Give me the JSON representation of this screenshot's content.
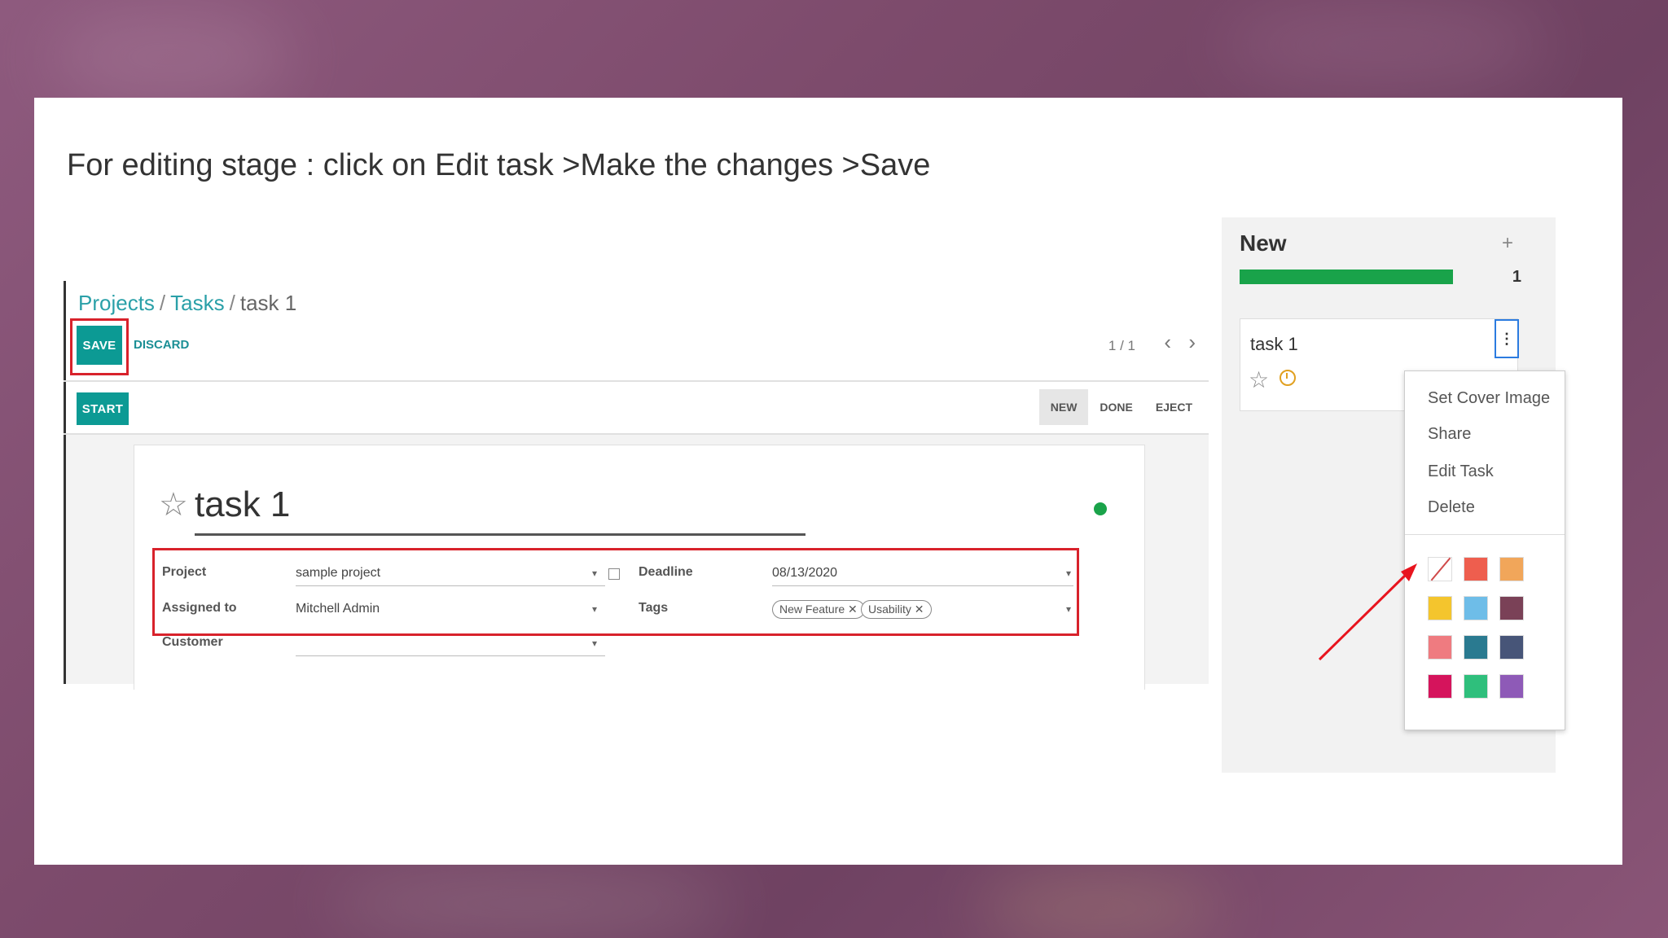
{
  "slide": {
    "caption": "For editing stage : click on Edit task >Make the changes >Save"
  },
  "form": {
    "breadcrumb": {
      "projects": "Projects",
      "tasks": "Tasks",
      "current": "task 1",
      "separator": "/"
    },
    "toolbar": {
      "save_label": "SAVE",
      "discard_label": "DISCARD",
      "pager": "1 / 1",
      "prev_icon": "chevron-left-icon",
      "next_icon": "chevron-right-icon"
    },
    "statusbar": {
      "start_label": "START",
      "stages": [
        "NEW",
        "DONE",
        "EJECT"
      ],
      "active_stage": "NEW"
    },
    "sheet": {
      "title": "task 1",
      "kanban_state_color": "#1aa34a",
      "fields": {
        "project_label": "Project",
        "project_value": "sample project",
        "assigned_label": "Assigned to",
        "assigned_value": "Mitchell Admin",
        "customer_label": "Customer",
        "customer_value": "",
        "deadline_label": "Deadline",
        "deadline_value": "08/13/2020",
        "tags_label": "Tags",
        "tags": [
          "New Feature",
          "Usability"
        ]
      }
    },
    "highlight_color": "#d8222b",
    "accent": "#0c9a94"
  },
  "kanban": {
    "column_title": "New",
    "column_count": "1",
    "progress_fraction": 1.0,
    "progress_color": "#19a34a",
    "card": {
      "title": "task 1",
      "menu_icon": "vertical-dots-icon"
    },
    "menu_items": [
      "Set Cover Image",
      "Share",
      "Edit Task",
      "Delete"
    ],
    "color_swatches": [
      "none",
      "#ee5e4e",
      "#f1a65a",
      "#f4c52d",
      "#6ebde8",
      "#7a4157",
      "#ef7b80",
      "#2a7a90",
      "#475578",
      "#d5145c",
      "#2fbf7c",
      "#8e5ab7"
    ]
  }
}
